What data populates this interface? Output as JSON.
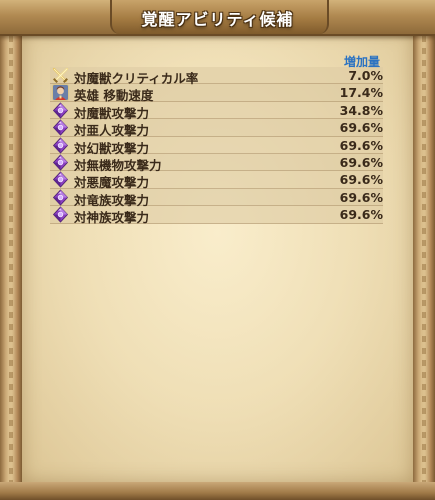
{
  "title": "覚醒アビリティ候補",
  "column_header": "増加量",
  "colors": {
    "header_blue": "#2a72c2",
    "text": "#3a2a1a",
    "gem_purple": "#8a3fc0",
    "sword_gold": "#d9b04a"
  },
  "abilities": [
    {
      "icon": "crossed-swords-icon",
      "name": "対魔獣クリティカル率",
      "value": "7.0%"
    },
    {
      "icon": "hero-portrait-icon",
      "name": "英雄 移動速度",
      "value": "17.4%"
    },
    {
      "icon": "purple-gem-icon",
      "name": "対魔獣攻撃力",
      "value": "34.8%"
    },
    {
      "icon": "purple-gem-icon",
      "name": "対亜人攻撃力",
      "value": "69.6%"
    },
    {
      "icon": "purple-gem-icon",
      "name": "対幻獣攻撃力",
      "value": "69.6%"
    },
    {
      "icon": "purple-gem-icon",
      "name": "対無機物攻撃力",
      "value": "69.6%"
    },
    {
      "icon": "purple-gem-icon",
      "name": "対悪魔攻撃力",
      "value": "69.6%"
    },
    {
      "icon": "purple-gem-icon",
      "name": "対竜族攻撃力",
      "value": "69.6%"
    },
    {
      "icon": "purple-gem-icon",
      "name": "対神族攻撃力",
      "value": "69.6%"
    }
  ]
}
